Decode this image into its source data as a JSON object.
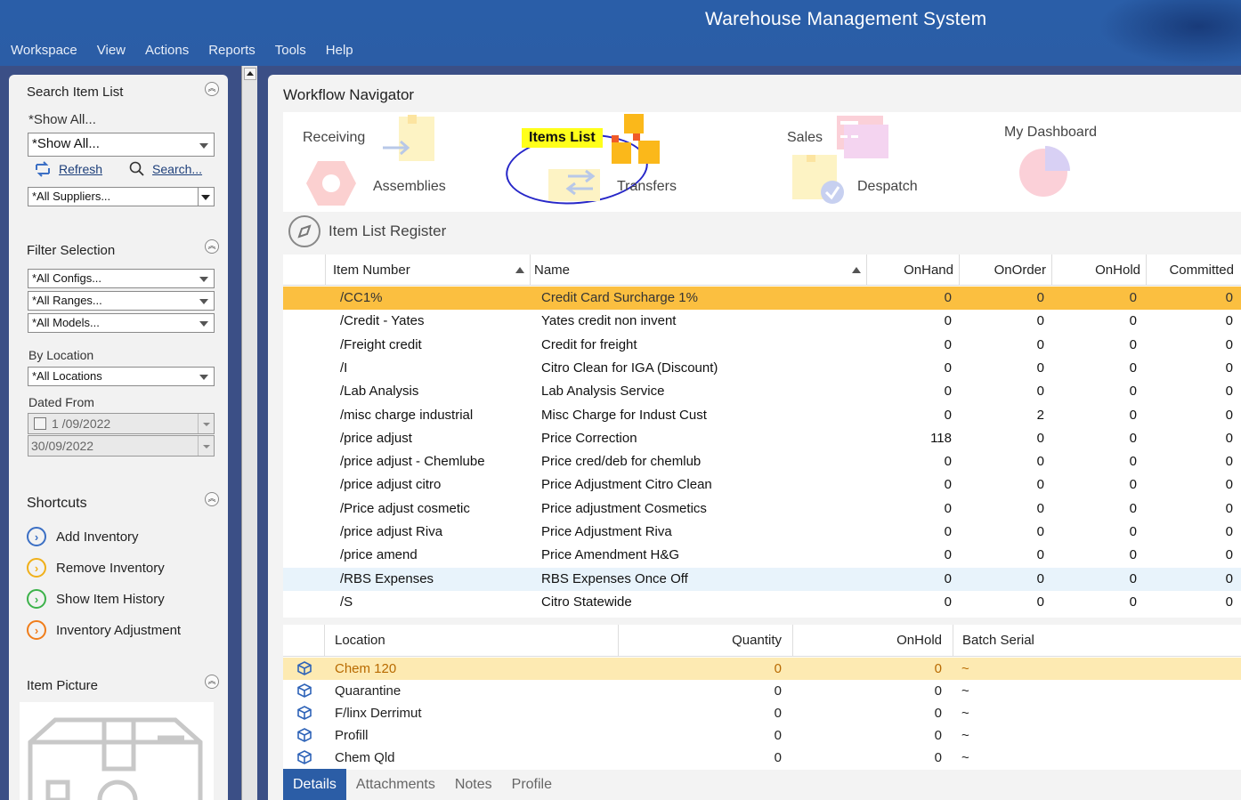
{
  "app": {
    "title": "Warehouse Management System",
    "menu": [
      "Workspace",
      "View",
      "Actions",
      "Reports",
      "Tools",
      "Help"
    ]
  },
  "left": {
    "search": {
      "title": "Search Item List",
      "show_all_label": "*Show All...",
      "show_all_value": "*Show All...",
      "refresh": "Refresh",
      "search": "Search...",
      "suppliers": "*All Suppliers..."
    },
    "filter": {
      "title": "Filter Selection",
      "configs": "*All Configs...",
      "ranges": "*All Ranges...",
      "models": "*All Models...",
      "by_location_label": "By Location",
      "locations": "*All Locations",
      "dated_from_label": "Dated From",
      "date_from": "1 /09/2022",
      "date_to": "30/09/2022"
    },
    "shortcuts": {
      "title": "Shortcuts",
      "items": [
        {
          "label": "Add Inventory",
          "color": "#3b6fc4"
        },
        {
          "label": "Remove Inventory",
          "color": "#f0b01a"
        },
        {
          "label": "Show Item History",
          "color": "#3cb24a"
        },
        {
          "label": "Inventory Adjustment",
          "color": "#f07d1a"
        }
      ]
    },
    "picture": {
      "title": "Item Picture"
    }
  },
  "workflow": {
    "title": "Workflow Navigator",
    "receiving": "Receiving",
    "items_list": "Items List",
    "sales": "Sales",
    "dashboard": "My Dashboard",
    "assemblies": "Assemblies",
    "transfers": "Transfers",
    "despatch": "Despatch"
  },
  "register": {
    "title": "Item List Register",
    "columns": [
      "Item Number",
      "Name",
      "OnHand",
      "OnOrder",
      "OnHold",
      "Committed"
    ],
    "rows": [
      {
        "item": "/CC1%",
        "name": "Credit Card Surcharge 1%",
        "onhand": "0",
        "onorder": "0",
        "onhold": "0",
        "committed": "0"
      },
      {
        "item": "/Credit - Yates",
        "name": "Yates credit non invent",
        "onhand": "0",
        "onorder": "0",
        "onhold": "0",
        "committed": "0"
      },
      {
        "item": "/Freight credit",
        "name": "Credit for freight",
        "onhand": "0",
        "onorder": "0",
        "onhold": "0",
        "committed": "0"
      },
      {
        "item": "/I",
        "name": "Citro Clean for IGA (Discount)",
        "onhand": "0",
        "onorder": "0",
        "onhold": "0",
        "committed": "0"
      },
      {
        "item": "/Lab Analysis",
        "name": "Lab Analysis Service",
        "onhand": "0",
        "onorder": "0",
        "onhold": "0",
        "committed": "0"
      },
      {
        "item": "/misc charge industrial",
        "name": "Misc Charge for Indust Cust",
        "onhand": "0",
        "onorder": "2",
        "onhold": "0",
        "committed": "0"
      },
      {
        "item": "/price adjust",
        "name": "Price Correction",
        "onhand": "118",
        "onorder": "0",
        "onhold": "0",
        "committed": "0"
      },
      {
        "item": "/price adjust - Chemlube",
        "name": "Price cred/deb for chemlub",
        "onhand": "0",
        "onorder": "0",
        "onhold": "0",
        "committed": "0"
      },
      {
        "item": "/price adjust citro",
        "name": "Price Adjustment Citro Clean",
        "onhand": "0",
        "onorder": "0",
        "onhold": "0",
        "committed": "0"
      },
      {
        "item": "/Price adjust cosmetic",
        "name": "Price adjustment Cosmetics",
        "onhand": "0",
        "onorder": "0",
        "onhold": "0",
        "committed": "0"
      },
      {
        "item": "/price adjust Riva",
        "name": "Price Adjustment Riva",
        "onhand": "0",
        "onorder": "0",
        "onhold": "0",
        "committed": "0"
      },
      {
        "item": "/price amend",
        "name": "Price Amendment H&G",
        "onhand": "0",
        "onorder": "0",
        "onhold": "0",
        "committed": "0"
      },
      {
        "item": "/RBS Expenses",
        "name": "RBS Expenses Once Off",
        "onhand": "0",
        "onorder": "0",
        "onhold": "0",
        "committed": "0"
      },
      {
        "item": "/S",
        "name": "Citro Statewide",
        "onhand": "0",
        "onorder": "0",
        "onhold": "0",
        "committed": "0"
      }
    ]
  },
  "locations": {
    "columns": [
      "Location",
      "Quantity",
      "OnHold",
      "Batch Serial"
    ],
    "rows": [
      {
        "location": "Chem 120",
        "quantity": "0",
        "onhold": "0",
        "batch": "~"
      },
      {
        "location": "Quarantine",
        "quantity": "0",
        "onhold": "0",
        "batch": "~"
      },
      {
        "location": "F/linx Derrimut",
        "quantity": "0",
        "onhold": "0",
        "batch": "~"
      },
      {
        "location": "Profill",
        "quantity": "0",
        "onhold": "0",
        "batch": "~"
      },
      {
        "location": "Chem Qld",
        "quantity": "0",
        "onhold": "0",
        "batch": "~"
      }
    ]
  },
  "tabs": [
    "Details",
    "Attachments",
    "Notes",
    "Profile"
  ],
  "colors": {
    "titlebar": "#2b5da6",
    "selected_row": "#fbbf40",
    "highlight": "#ffff1a",
    "annotation_ring": "#2727c8"
  }
}
